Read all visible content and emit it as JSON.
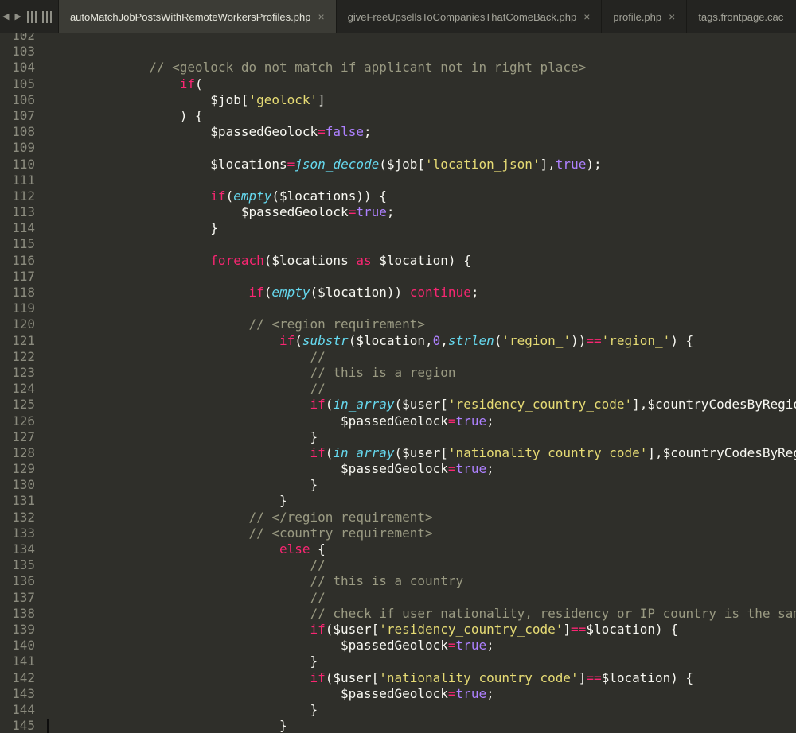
{
  "tabbar": {
    "nav": {
      "back_icon": "◀",
      "forward_icon": "▶"
    },
    "tabs": [
      {
        "label": "autoMatchJobPostsWithRemoteWorkersProfiles.php",
        "close": "×",
        "active": true,
        "clipped": false
      },
      {
        "label": "giveFreeUpsellsToCompaniesThatComeBack.php",
        "close": "×",
        "active": false,
        "clipped": false
      },
      {
        "label": "profile.php",
        "close": "×",
        "active": false,
        "clipped": false
      },
      {
        "label": "tags.frontpage.cac",
        "close": "",
        "active": false,
        "clipped": true
      }
    ]
  },
  "editor": {
    "language": "php",
    "background": "#2f2f2a",
    "gutter_color": "#8b8b7e",
    "token_colors": {
      "pl": "#f8f8f2",
      "kw": "#f92672",
      "fn": "#66d9ef",
      "st": "#e6db74",
      "ct": "#ae81ff",
      "cm": "#9a9a82"
    },
    "first_line_number": 102,
    "lines": [
      {
        "n": 102,
        "ind": 0,
        "tokens": []
      },
      {
        "n": 103,
        "ind": 0,
        "tokens": []
      },
      {
        "n": 104,
        "ind": 13,
        "tokens": [
          [
            "cm",
            "// <geolock do not match if applicant not in right place>"
          ]
        ]
      },
      {
        "n": 105,
        "ind": 17,
        "tokens": [
          [
            "kw",
            "if"
          ],
          [
            "pl",
            "("
          ]
        ]
      },
      {
        "n": 106,
        "ind": 21,
        "tokens": [
          [
            "pl",
            "$job["
          ],
          [
            "st",
            "'geolock'"
          ],
          [
            "pl",
            "]"
          ]
        ]
      },
      {
        "n": 107,
        "ind": 17,
        "tokens": [
          [
            "pl",
            ") {"
          ]
        ]
      },
      {
        "n": 108,
        "ind": 21,
        "tokens": [
          [
            "pl",
            "$passedGeolock"
          ],
          [
            "kw",
            "="
          ],
          [
            "ct",
            "false"
          ],
          [
            "pl",
            ";"
          ]
        ]
      },
      {
        "n": 109,
        "ind": 0,
        "tokens": []
      },
      {
        "n": 110,
        "ind": 21,
        "tokens": [
          [
            "pl",
            "$locations"
          ],
          [
            "kw",
            "="
          ],
          [
            "fn",
            "json_decode"
          ],
          [
            "pl",
            "($job["
          ],
          [
            "st",
            "'location_json'"
          ],
          [
            "pl",
            "],"
          ],
          [
            "ct",
            "true"
          ],
          [
            "pl",
            ");"
          ]
        ]
      },
      {
        "n": 111,
        "ind": 0,
        "tokens": []
      },
      {
        "n": 112,
        "ind": 21,
        "tokens": [
          [
            "kw",
            "if"
          ],
          [
            "pl",
            "("
          ],
          [
            "fn",
            "empty"
          ],
          [
            "pl",
            "($locations)) {"
          ]
        ]
      },
      {
        "n": 113,
        "ind": 25,
        "tokens": [
          [
            "pl",
            "$passedGeolock"
          ],
          [
            "kw",
            "="
          ],
          [
            "ct",
            "true"
          ],
          [
            "pl",
            ";"
          ]
        ]
      },
      {
        "n": 114,
        "ind": 21,
        "tokens": [
          [
            "pl",
            "}"
          ]
        ]
      },
      {
        "n": 115,
        "ind": 0,
        "tokens": []
      },
      {
        "n": 116,
        "ind": 21,
        "tokens": [
          [
            "kw",
            "foreach"
          ],
          [
            "pl",
            "($locations "
          ],
          [
            "kw",
            "as"
          ],
          [
            "pl",
            " $location) {"
          ]
        ]
      },
      {
        "n": 117,
        "ind": 0,
        "tokens": []
      },
      {
        "n": 118,
        "ind": 26,
        "tokens": [
          [
            "kw",
            "if"
          ],
          [
            "pl",
            "("
          ],
          [
            "fn",
            "empty"
          ],
          [
            "pl",
            "($location)) "
          ],
          [
            "kw",
            "continue"
          ],
          [
            "pl",
            ";"
          ]
        ]
      },
      {
        "n": 119,
        "ind": 0,
        "tokens": []
      },
      {
        "n": 120,
        "ind": 26,
        "tokens": [
          [
            "cm",
            "// <region requirement>"
          ]
        ]
      },
      {
        "n": 121,
        "ind": 30,
        "tokens": [
          [
            "kw",
            "if"
          ],
          [
            "pl",
            "("
          ],
          [
            "fn",
            "substr"
          ],
          [
            "pl",
            "($location,"
          ],
          [
            "ct",
            "0"
          ],
          [
            "pl",
            ","
          ],
          [
            "fn",
            "strlen"
          ],
          [
            "pl",
            "("
          ],
          [
            "st",
            "'region_'"
          ],
          [
            "pl",
            "))"
          ],
          [
            "kw",
            "=="
          ],
          [
            "st",
            "'region_'"
          ],
          [
            "pl",
            ") {"
          ]
        ]
      },
      {
        "n": 122,
        "ind": 34,
        "tokens": [
          [
            "cm",
            "//"
          ]
        ]
      },
      {
        "n": 123,
        "ind": 34,
        "tokens": [
          [
            "cm",
            "// this is a region"
          ]
        ]
      },
      {
        "n": 124,
        "ind": 34,
        "tokens": [
          [
            "cm",
            "//"
          ]
        ]
      },
      {
        "n": 125,
        "ind": 34,
        "tokens": [
          [
            "kw",
            "if"
          ],
          [
            "pl",
            "("
          ],
          [
            "fn",
            "in_array"
          ],
          [
            "pl",
            "($user["
          ],
          [
            "st",
            "'residency_country_code'"
          ],
          [
            "pl",
            "],$countryCodesByRegion[$location])) {"
          ]
        ]
      },
      {
        "n": 126,
        "ind": 38,
        "tokens": [
          [
            "pl",
            "$passedGeolock"
          ],
          [
            "kw",
            "="
          ],
          [
            "ct",
            "true"
          ],
          [
            "pl",
            ";"
          ]
        ]
      },
      {
        "n": 127,
        "ind": 34,
        "tokens": [
          [
            "pl",
            "}"
          ]
        ]
      },
      {
        "n": 128,
        "ind": 34,
        "tokens": [
          [
            "kw",
            "if"
          ],
          [
            "pl",
            "("
          ],
          [
            "fn",
            "in_array"
          ],
          [
            "pl",
            "($user["
          ],
          [
            "st",
            "'nationality_country_code'"
          ],
          [
            "pl",
            "],$countryCodesByRegion[$location])) {"
          ]
        ]
      },
      {
        "n": 129,
        "ind": 38,
        "tokens": [
          [
            "pl",
            "$passedGeolock"
          ],
          [
            "kw",
            "="
          ],
          [
            "ct",
            "true"
          ],
          [
            "pl",
            ";"
          ]
        ]
      },
      {
        "n": 130,
        "ind": 34,
        "tokens": [
          [
            "pl",
            "}"
          ]
        ]
      },
      {
        "n": 131,
        "ind": 30,
        "tokens": [
          [
            "pl",
            "}"
          ]
        ]
      },
      {
        "n": 132,
        "ind": 26,
        "tokens": [
          [
            "cm",
            "// </region requirement>"
          ]
        ]
      },
      {
        "n": 133,
        "ind": 26,
        "tokens": [
          [
            "cm",
            "// <country requirement>"
          ]
        ]
      },
      {
        "n": 134,
        "ind": 30,
        "tokens": [
          [
            "kw",
            "else"
          ],
          [
            "pl",
            " {"
          ]
        ]
      },
      {
        "n": 135,
        "ind": 34,
        "tokens": [
          [
            "cm",
            "//"
          ]
        ]
      },
      {
        "n": 136,
        "ind": 34,
        "tokens": [
          [
            "cm",
            "// this is a country"
          ]
        ]
      },
      {
        "n": 137,
        "ind": 34,
        "tokens": [
          [
            "cm",
            "//"
          ]
        ]
      },
      {
        "n": 138,
        "ind": 34,
        "tokens": [
          [
            "cm",
            "// check if user nationality, residency or IP country is the same"
          ]
        ]
      },
      {
        "n": 139,
        "ind": 34,
        "tokens": [
          [
            "kw",
            "if"
          ],
          [
            "pl",
            "($user["
          ],
          [
            "st",
            "'residency_country_code'"
          ],
          [
            "pl",
            "]"
          ],
          [
            "kw",
            "=="
          ],
          [
            "pl",
            "$location) {"
          ]
        ]
      },
      {
        "n": 140,
        "ind": 38,
        "tokens": [
          [
            "pl",
            "$passedGeolock"
          ],
          [
            "kw",
            "="
          ],
          [
            "ct",
            "true"
          ],
          [
            "pl",
            ";"
          ]
        ]
      },
      {
        "n": 141,
        "ind": 34,
        "tokens": [
          [
            "pl",
            "}"
          ]
        ]
      },
      {
        "n": 142,
        "ind": 34,
        "tokens": [
          [
            "kw",
            "if"
          ],
          [
            "pl",
            "($user["
          ],
          [
            "st",
            "'nationality_country_code'"
          ],
          [
            "pl",
            "]"
          ],
          [
            "kw",
            "=="
          ],
          [
            "pl",
            "$location) {"
          ]
        ]
      },
      {
        "n": 143,
        "ind": 38,
        "tokens": [
          [
            "pl",
            "$passedGeolock"
          ],
          [
            "kw",
            "="
          ],
          [
            "ct",
            "true"
          ],
          [
            "pl",
            ";"
          ]
        ]
      },
      {
        "n": 144,
        "ind": 34,
        "tokens": [
          [
            "pl",
            "}"
          ]
        ]
      },
      {
        "n": 145,
        "ind": 30,
        "tokens": [
          [
            "pl",
            "}"
          ]
        ]
      }
    ]
  }
}
